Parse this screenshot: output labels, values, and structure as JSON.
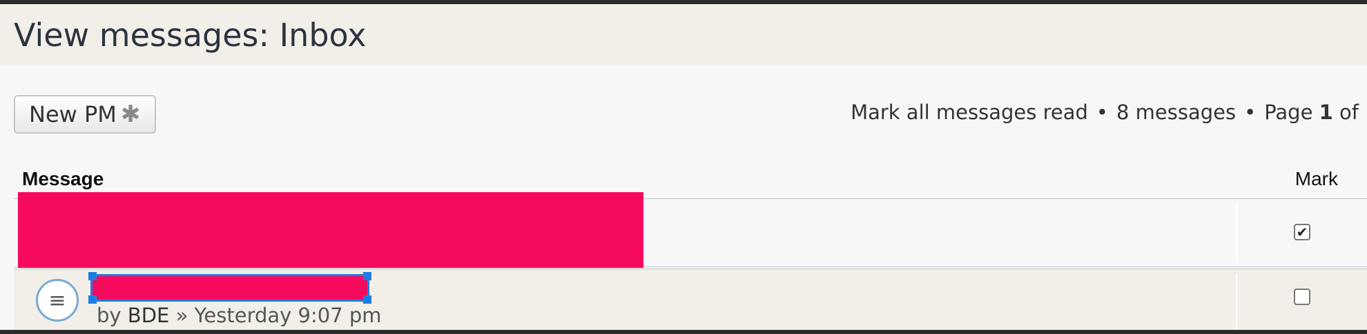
{
  "header": {
    "title": "View messages: Inbox"
  },
  "toolbar": {
    "new_pm_label": "New PM",
    "new_pm_icon": "asterisk-icon"
  },
  "pagination": {
    "mark_all_read": "Mark all messages read",
    "separator": "•",
    "message_count": "8 messages",
    "page_prefix": "Page",
    "current_page": "1",
    "page_suffix": "of"
  },
  "table": {
    "columns": {
      "message": "Message",
      "mark": "Mark"
    },
    "rows": [
      {
        "title": "",
        "checked": true
      },
      {
        "title": "",
        "by_prefix": "by",
        "author": "BDE",
        "separator": "»",
        "time": "Yesterday 9:07 pm",
        "checked": false
      }
    ]
  },
  "colors": {
    "redaction": "#f50a5e",
    "selection": "#1e7de0",
    "header_bg": "#f1efe7"
  }
}
